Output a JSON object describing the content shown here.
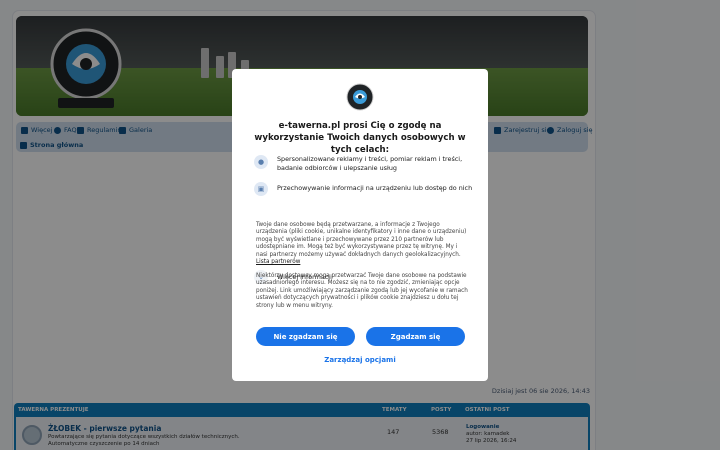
{
  "nav": {
    "left_items": [
      {
        "label": "Więcej",
        "icon": "menu-icon"
      },
      {
        "label": "FAQ",
        "icon": "question-icon"
      },
      {
        "label": "Regulamin",
        "icon": "book-icon"
      },
      {
        "label": "Galeria",
        "icon": "camera-icon"
      }
    ],
    "right_items": [
      {
        "label": "Zarejestruj się",
        "icon": "register-icon"
      },
      {
        "label": "Zaloguj się",
        "icon": "login-icon"
      }
    ],
    "breadcrumb": "Strona główna"
  },
  "forum": {
    "date_line": "Dzisiaj jest 06 sie 2026, 14:43",
    "category": {
      "title": "TAWERNA PREZENTUJE",
      "col_topics": "TEMATY",
      "col_posts": "POSTY",
      "col_last": "OSTATNI POST",
      "rows": [
        {
          "title": "ŻŁOBEK - pierwsze pytania",
          "desc1": "Powtarzające się pytania dotyczące wszystkich działów technicznych.",
          "desc2": "Automatyczne czyszczenie po 14 dniach",
          "topics": "147",
          "posts": "5368",
          "last_title": "Logowanie",
          "last_author": "autor: kamadek",
          "last_date": "27 lip 2026, 16:24"
        }
      ]
    }
  },
  "dialog": {
    "title": "e-tawerna.pl prosi Cię o zgodę na wykorzystanie Twoich danych osobowych w tych celach:",
    "purposes": [
      {
        "icon": "user-icon",
        "text": "Spersonalizowane reklamy i treści, pomiar reklam i treści, badanie odbiorców i ulepszanie usług"
      },
      {
        "icon": "device-icon",
        "text": "Przechowywanie informacji na urządzeniu lub dostęp do nich"
      }
    ],
    "more_label": "Więcej informacji",
    "paragraph1": "Twoje dane osobowe będą przetwarzane, a informacje z Twojego urządzenia (pliki cookie, unikalne identyfikatory i inne dane o urządzeniu) mogą być wyświetlane i przechowywane przez 210 partnerów lub udostępniane im. Mogą też być wykorzystywane przez tę witrynę. My i nasi partnerzy możemy używać dokładnych danych geolokalizacyjnych.",
    "partners_link": "Lista partnerów",
    "paragraph2": "Niektórzy dostawcy mogą przetwarzać Twoje dane osobowe na podstawie uzasadnionego interesu. Możesz się na to nie zgodzić, zmieniając opcje poniżej. Link umożliwiający zarządzanie zgodą lub jej wycofanie w ramach ustawień dotyczących prywatności i plików cookie znajdziesz u dołu tej strony lub w menu witryny.",
    "decline_label": "Nie zgadzam się",
    "accept_label": "Zgadzam się",
    "manage_label": "Zarządzaj opcjami"
  },
  "colors": {
    "accent": "#1a73e8",
    "forum_blue": "#0f7fbd",
    "link_blue": "#105289"
  }
}
